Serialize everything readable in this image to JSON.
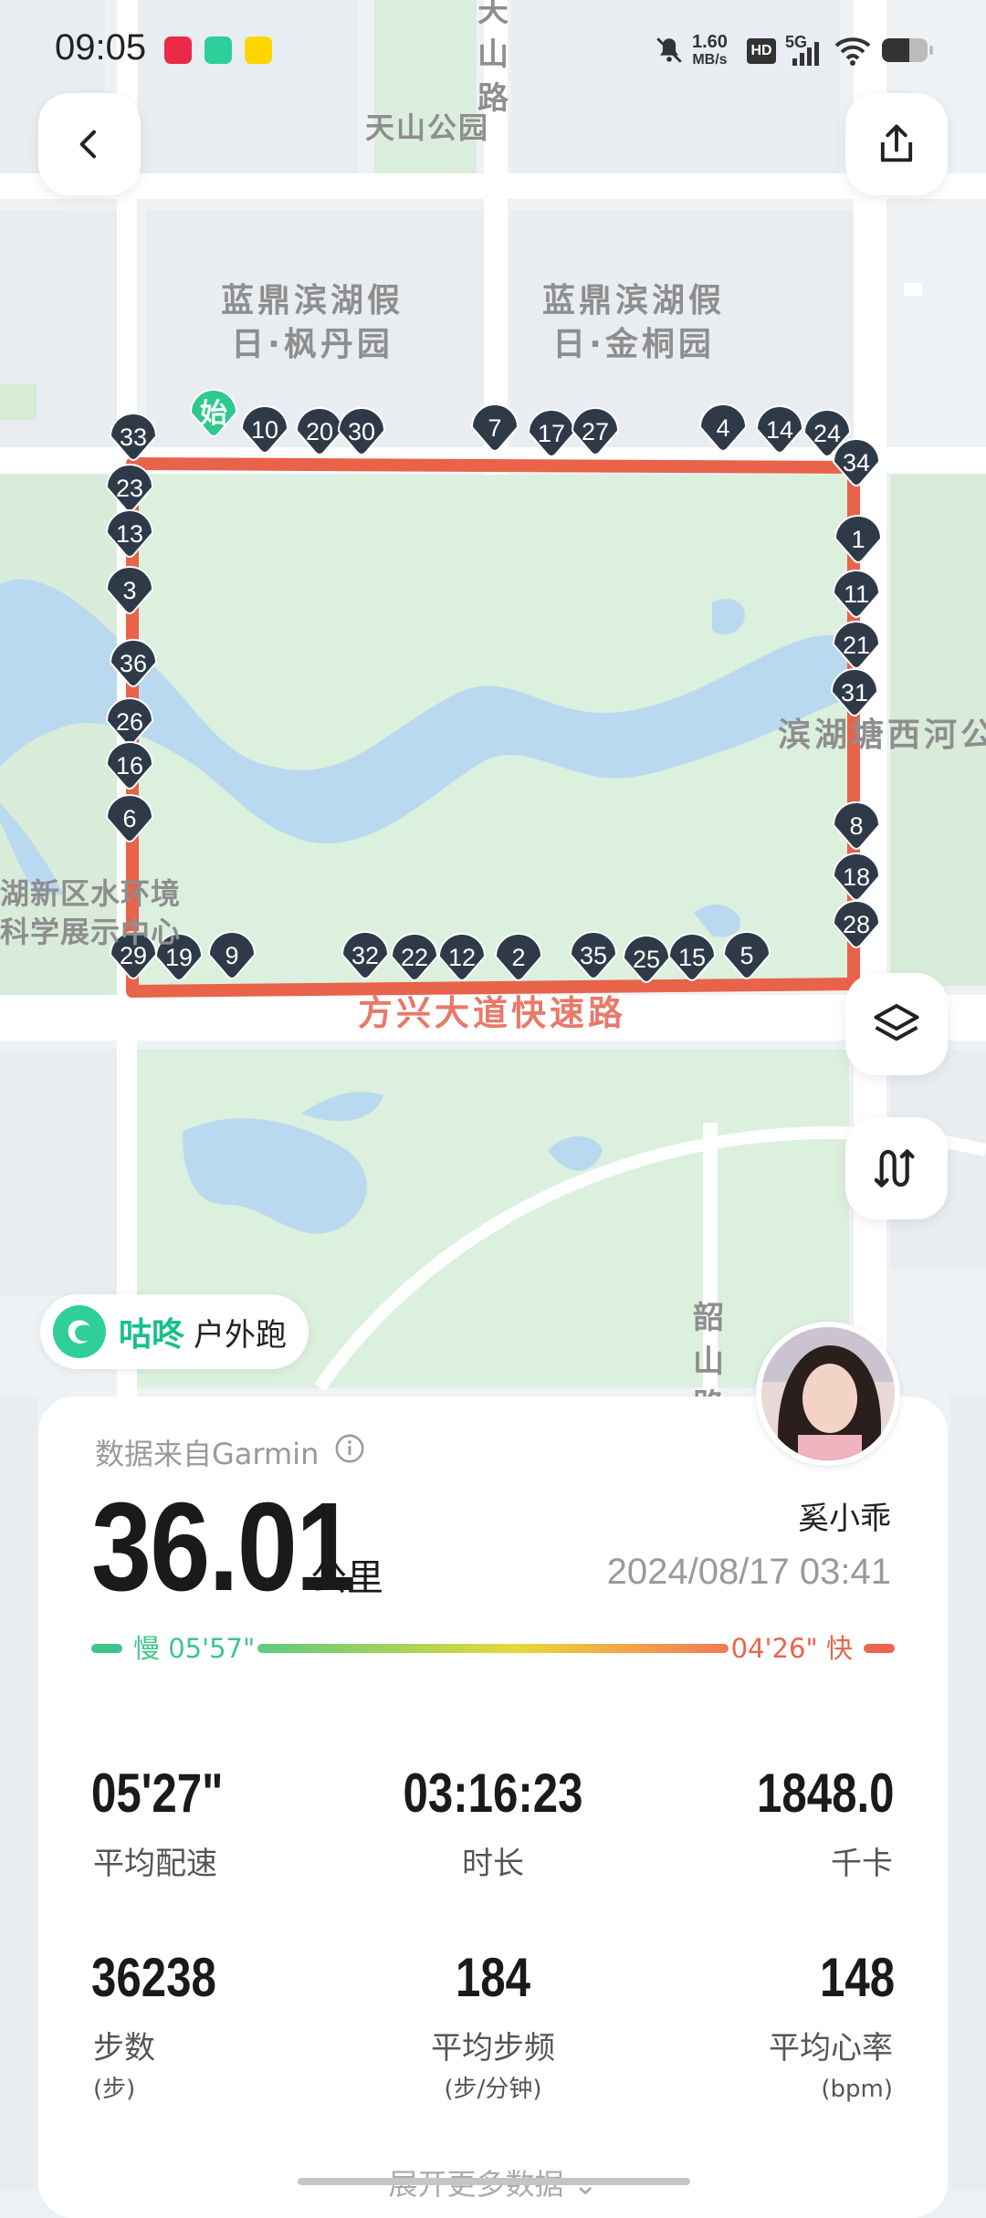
{
  "status_bar": {
    "time": "09:05",
    "app_icons": [
      "小红书",
      "咕咚",
      "闲鱼"
    ],
    "network_speed_value": "1.60",
    "network_speed_unit": "MB/s",
    "hd": "HD",
    "network_type": "5G",
    "icons": [
      "mute-icon",
      "signal-icon",
      "wifi-icon",
      "battery-icon"
    ]
  },
  "map": {
    "labels": {
      "road_top": "天山路",
      "park": "天山公园",
      "block_left": "蓝鼎滨湖假日·枫丹园",
      "block_right": "蓝鼎滨湖假日·金桐园",
      "river": "滨湖塘西河公",
      "science": "湖新区水环境科学展示中心",
      "road_bottom": "方兴大道快速路",
      "road_right": "韶山路"
    },
    "start_marker": "始",
    "markers": [
      "33",
      "23",
      "13",
      "3",
      "36",
      "26",
      "16",
      "6",
      "29",
      "19",
      "9",
      "10",
      "20",
      "30",
      "7",
      "17",
      "27",
      "4",
      "14",
      "24",
      "34",
      "1",
      "11",
      "21",
      "31",
      "8",
      "18",
      "28",
      "32",
      "22",
      "12",
      "2",
      "35",
      "25",
      "15",
      "5"
    ],
    "route_color": "#e8634a",
    "marker_color": "#2f3a49",
    "start_color": "#2ec98e"
  },
  "toolbar": {
    "back_icon": "chevron-left-icon",
    "share_icon": "share-icon",
    "layers_icon": "layers-icon",
    "route_icon": "route-icon"
  },
  "badge": {
    "brand": "咕咚",
    "type": "户外跑"
  },
  "summary": {
    "source": "数据来自Garmin",
    "distance": "36.01",
    "distance_unit": "公里",
    "username": "奚小乖",
    "datetime": "2024/08/17 03:41",
    "pace_slow": "慢 05'57\"",
    "pace_fast": "04'26\" 快"
  },
  "stats": [
    {
      "value": "05'27\"",
      "label": "平均配速",
      "sub": ""
    },
    {
      "value": "03:16:23",
      "label": "时长",
      "sub": ""
    },
    {
      "value": "1848.0",
      "label": "千卡",
      "sub": ""
    },
    {
      "value": "36238",
      "label": "步数",
      "sub": "(步)"
    },
    {
      "value": "184",
      "label": "平均步频",
      "sub": "(步/分钟)"
    },
    {
      "value": "148",
      "label": "平均心率",
      "sub": "(bpm)"
    }
  ],
  "more_data": "展开更多数据"
}
